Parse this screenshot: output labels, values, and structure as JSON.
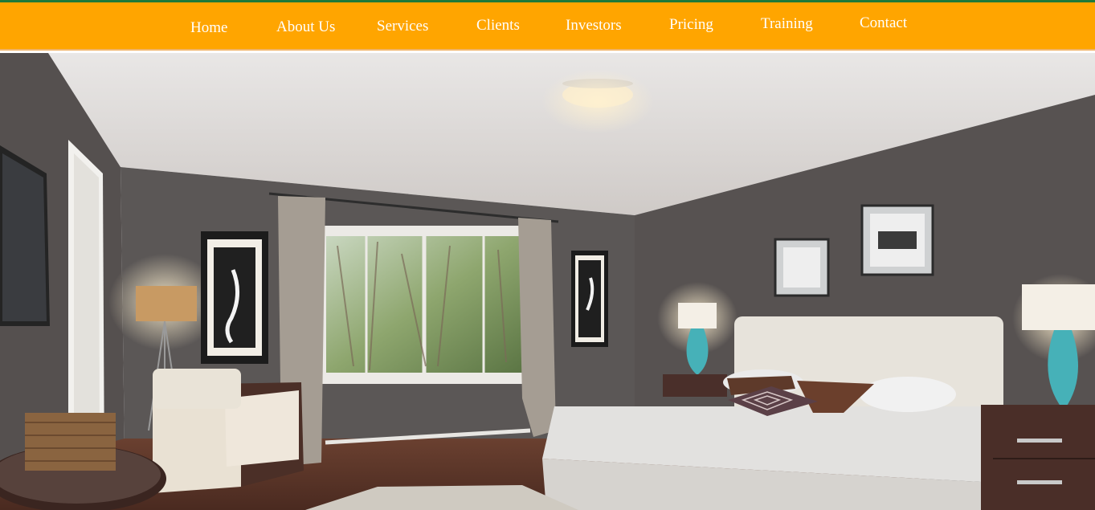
{
  "nav": {
    "items": [
      {
        "label": "Home"
      },
      {
        "label": "About Us"
      },
      {
        "label": "Services"
      },
      {
        "label": "Clients"
      },
      {
        "label": "Investors"
      },
      {
        "label": "Pricing"
      },
      {
        "label": "Training"
      },
      {
        "label": "Contact"
      }
    ]
  },
  "hero": {
    "image": "bedroom-interior-photo"
  },
  "colors": {
    "nav_background": "#ffa500",
    "top_stripe": "#1f7a3a",
    "nav_text": "#ffffff"
  }
}
